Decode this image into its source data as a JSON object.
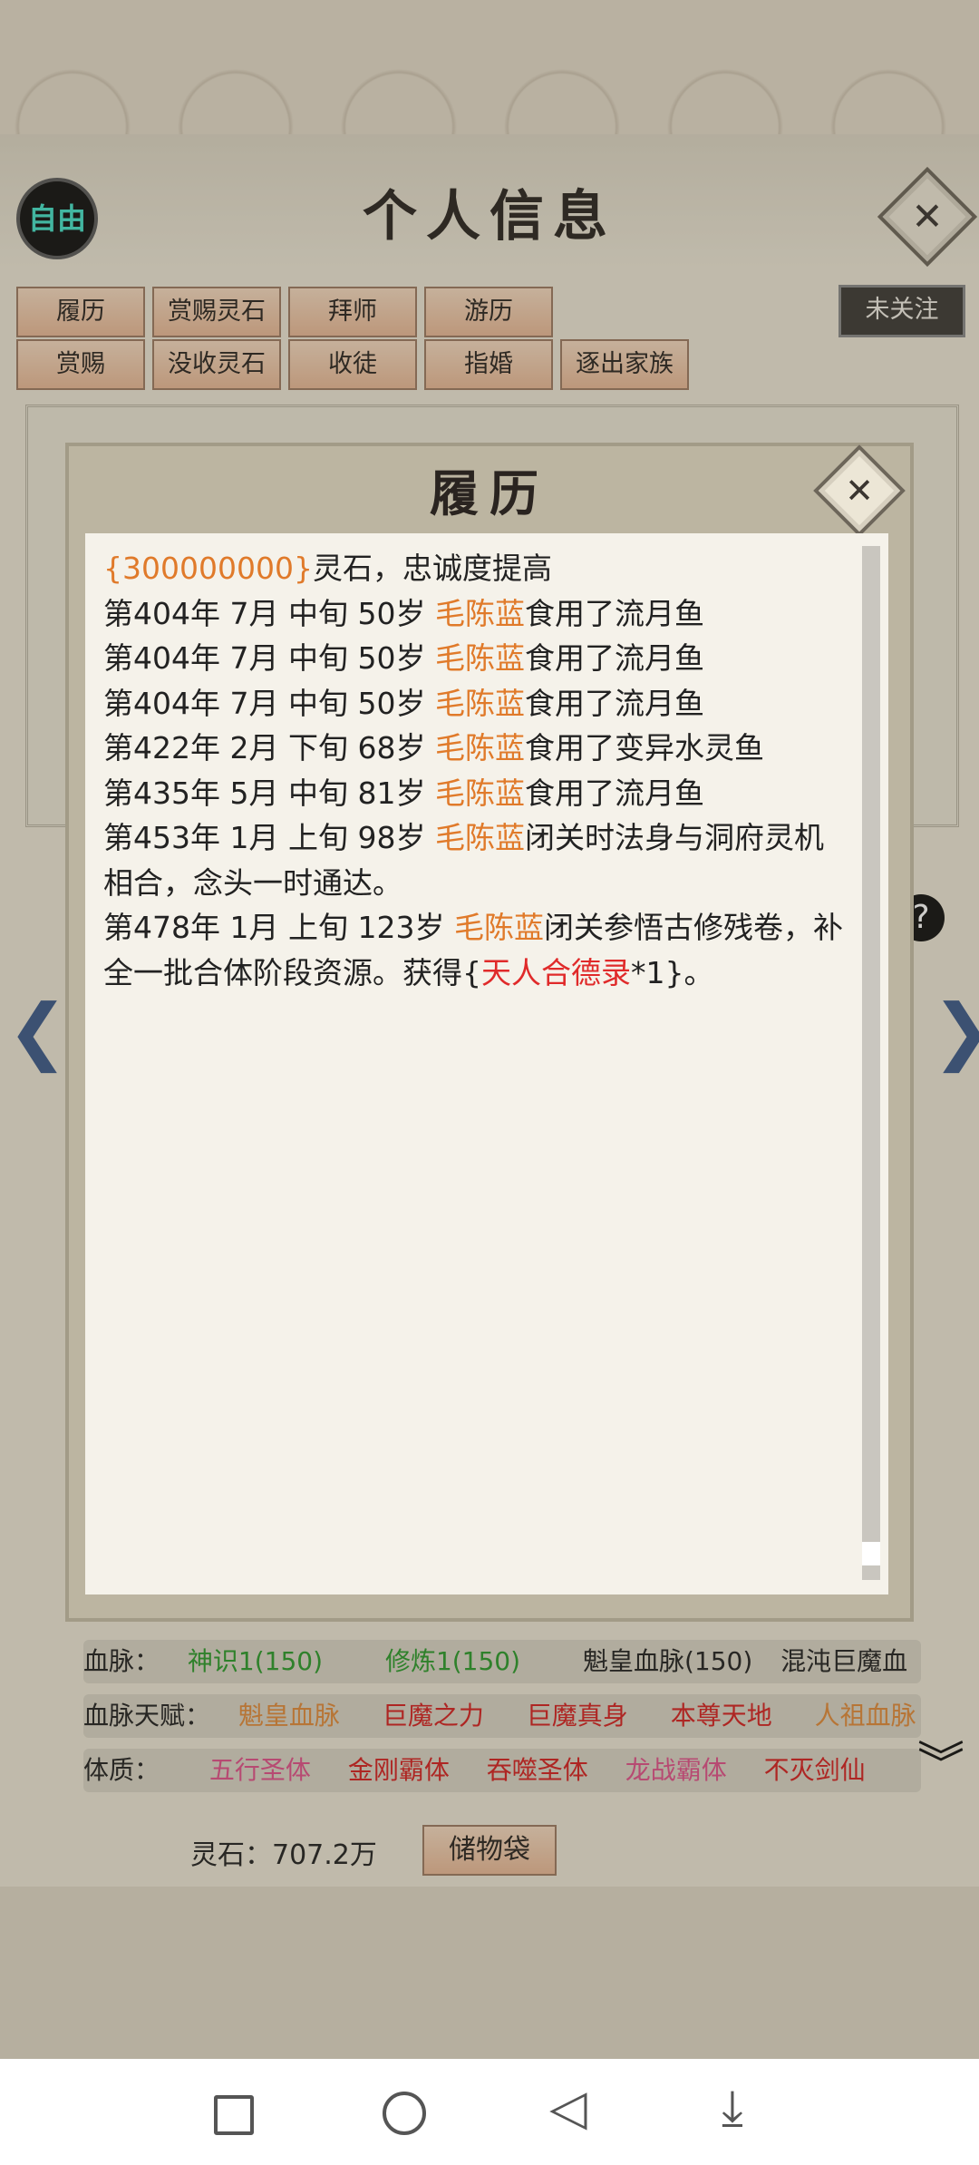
{
  "header": {
    "title": "个人信息",
    "free_badge": "自由",
    "follow_label": "未关注"
  },
  "actions": {
    "row1": [
      "履历",
      "赏赐灵石",
      "拜师",
      "游历"
    ],
    "row2": [
      "赏赐",
      "没收灵石",
      "收徒",
      "指婚",
      "逐出家族"
    ]
  },
  "stats": {
    "bloodline_label": "血脉：",
    "bloodlines": [
      "神识1(150)",
      "修炼1(150)",
      "魁皇血脉(150)",
      "混沌巨魔血"
    ],
    "bloodline_talent_label": "血脉天赋：",
    "bloodline_talents": [
      "魁皇血脉",
      "巨魔之力",
      "巨魔真身",
      "本尊天地",
      "人祖血脉"
    ],
    "physique_label": "体质：",
    "physiques": [
      "五行圣体",
      "金刚霸体",
      "吞噬圣体",
      "龙战霸体",
      "不灭剑仙"
    ]
  },
  "footer": {
    "spirit_stones": "灵石：707.2万",
    "storage_label": "储物袋"
  },
  "modal": {
    "title": "履历",
    "close_icon": "close-icon",
    "entries": [
      {
        "parts": [
          {
            "t": "{300000000}",
            "c": "o"
          },
          {
            "t": "灵石，忠诚度提高",
            "c": ""
          }
        ]
      },
      {
        "parts": [
          {
            "t": "第404年 7月 中旬  50岁  ",
            "c": ""
          },
          {
            "t": "毛陈蓝",
            "c": "o"
          },
          {
            "t": "食用了流月鱼",
            "c": ""
          }
        ]
      },
      {
        "parts": [
          {
            "t": "第404年 7月 中旬  50岁  ",
            "c": ""
          },
          {
            "t": "毛陈蓝",
            "c": "o"
          },
          {
            "t": "食用了流月鱼",
            "c": ""
          }
        ]
      },
      {
        "parts": [
          {
            "t": "第404年 7月 中旬  50岁  ",
            "c": ""
          },
          {
            "t": "毛陈蓝",
            "c": "o"
          },
          {
            "t": "食用了流月鱼",
            "c": ""
          }
        ]
      },
      {
        "parts": [
          {
            "t": "第422年 2月 下旬  68岁  ",
            "c": ""
          },
          {
            "t": "毛陈蓝",
            "c": "o"
          },
          {
            "t": "食用了变异水灵鱼",
            "c": ""
          }
        ]
      },
      {
        "parts": [
          {
            "t": "第435年 5月 中旬  81岁  ",
            "c": ""
          },
          {
            "t": "毛陈蓝",
            "c": "o"
          },
          {
            "t": "食用了流月鱼",
            "c": ""
          }
        ]
      },
      {
        "parts": [
          {
            "t": "第453年 1月 上旬  98岁  ",
            "c": ""
          },
          {
            "t": "毛陈蓝",
            "c": "o"
          },
          {
            "t": "闭关时法身与洞府灵机相合，念头一时通达。",
            "c": ""
          }
        ]
      },
      {
        "parts": [
          {
            "t": "第478年 1月 上旬  123岁  ",
            "c": ""
          },
          {
            "t": "毛陈蓝",
            "c": "o"
          },
          {
            "t": "闭关参悟古修残卷，补全一批合体阶段资源。获得{",
            "c": ""
          },
          {
            "t": "天人合德录",
            "c": "r"
          },
          {
            "t": "*1}。",
            "c": ""
          }
        ]
      }
    ]
  },
  "colors": {
    "orange": "#e07a2a",
    "red": "#e02a2a",
    "button_fill": "#eebd9a",
    "panel_bg": "#ece6d6"
  }
}
